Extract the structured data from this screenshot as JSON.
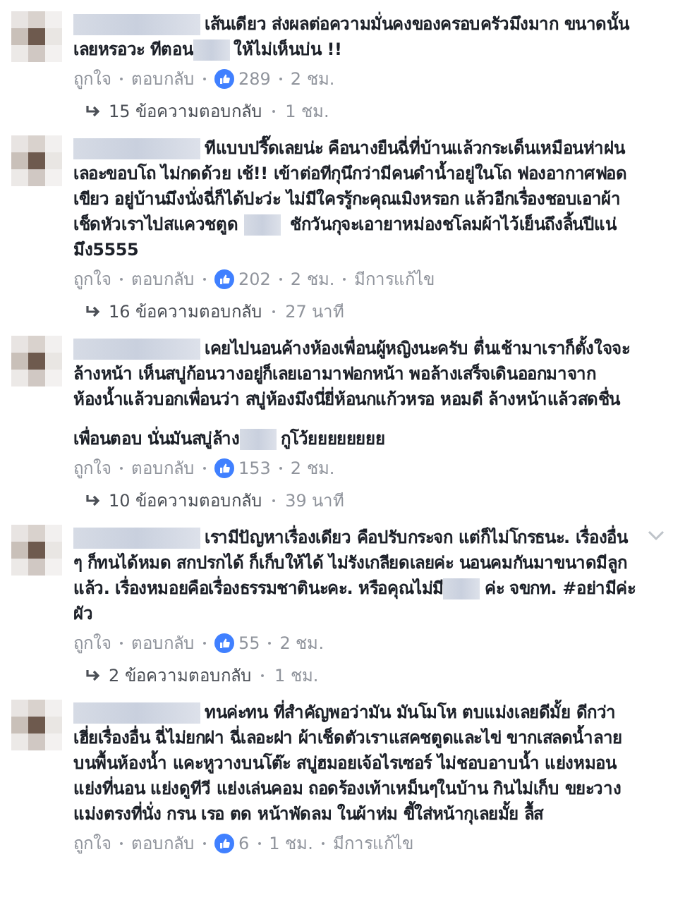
{
  "comments": [
    {
      "paragraphs": [
        [
          {
            "kind": "name"
          },
          {
            "kind": "text",
            "text": "เส้นเดียว ส่งผลต่อความมั่นคงของครอบครัวมึงมาก ขนาดนั้นเลยหรอวะ ทีตอน"
          },
          {
            "kind": "redacted"
          },
          {
            "kind": "text",
            "text": "ให้ไม่เห็นบ่น !!"
          }
        ]
      ],
      "actions": [
        "ถูกใจ",
        "ตอบกลับ"
      ],
      "likes": "289",
      "time": "2 ชม.",
      "replies": {
        "count": "15 ข้อความตอบกลับ",
        "time": "1 ชม."
      },
      "menu": false
    },
    {
      "paragraphs": [
        [
          {
            "kind": "name"
          },
          {
            "kind": "text",
            "text": "ทีแบบปรี๊ดเลยน่ะ คือนางยืนฉี่ที่บ้านแล้วกระเด็นเหมือนห่าฝนเลอะขอบโถ ไม่กดด้วย เช้!! เข้าต่อทีกุนึกว่ามีคนดำน้ำอยู่ในโถ ฟองอากาศฟอดเขียว อยู่บ้านมึงนั่งฉี่ก็ได้ปะว่ะ ไม่มีใครรู้กะคุณเมิงหรอก แล้วอีกเรื่องชอบเอาผ้าเช็ดหัวเราไปสแควชตูด "
          },
          {
            "kind": "redacted"
          },
          {
            "kind": "text",
            "text": " ชักวันกุจะเอายาหม่องชโลมผ้าไว้เย็นถึงลิ้นปีแน่มึง5555"
          }
        ]
      ],
      "actions": [
        "ถูกใจ",
        "ตอบกลับ"
      ],
      "likes": "202",
      "time": "2 ชม.",
      "edited": "มีการแก้ไข",
      "replies": {
        "count": "16 ข้อความตอบกลับ",
        "time": "27 นาที"
      },
      "menu": false
    },
    {
      "paragraphs": [
        [
          {
            "kind": "name"
          },
          {
            "kind": "text",
            "text": "เคยไปนอนค้างห้องเพื่อนผู้หญิงนะครับ ตื่นเช้ามาเราก็ตั้งใจจะล้างหน้า เห็นสบู่ก้อนวางอยู่ก็เลยเอามาฟอกหน้า พอล้างเสร็จเดินออกมาจากห้องน้ำแล้วบอกเพื่อนว่า สบู่ห้องมึงนี่ยี่ห้อนกแก้วหรอ หอมดี ล้างหน้าแล้วสดชื่น"
          }
        ],
        [
          {
            "kind": "text",
            "text": "เพื่อนตอบ นั่นมันสบู่ล้าง"
          },
          {
            "kind": "redacted"
          },
          {
            "kind": "text",
            "text": "กูโว้ยยยยยยยย"
          }
        ]
      ],
      "actions": [
        "ถูกใจ",
        "ตอบกลับ"
      ],
      "likes": "153",
      "time": "2 ชม.",
      "replies": {
        "count": "10 ข้อความตอบกลับ",
        "time": "39 นาที"
      },
      "menu": false
    },
    {
      "paragraphs": [
        [
          {
            "kind": "name"
          },
          {
            "kind": "text",
            "text": "เรามีปัญหาเรื่องเดียว คือปรับกระจก แต่ก็ไม่โกรธนะ. เรื่องอื่น ๆ ก็ทนได้หมด สกปรกได้ ก็เก็บให้ได้ ไม่รังเกลียดเลยค่ะ นอนคมกันมาขนาดมีลูกแล้ว. เรื่องหมอยคือเรื่องธรรมชาตินะคะ. หรือคุณไม่มี"
          },
          {
            "kind": "redacted"
          },
          {
            "kind": "text",
            "text": "ค่ะ จขกท. #อย่ามีค่ะผัว"
          }
        ]
      ],
      "actions": [
        "ถูกใจ",
        "ตอบกลับ"
      ],
      "likes": "55",
      "time": "2 ชม.",
      "replies": {
        "count": "2 ข้อความตอบกลับ",
        "time": "1 ชม."
      },
      "menu": true
    },
    {
      "paragraphs": [
        [
          {
            "kind": "name"
          },
          {
            "kind": "text",
            "text": "ทนค่ะทน ที่สำคัญพอว่ามัน มันโมโห ตบแม่งเลยดีมั้ย ดีกว่าเฮี่ยเรื่องอื่น ฉี่ไม่ยกฝา ฉี่เลอะฝา ผ้าเช็ดตัวเราแสคชตูดและไข่ ขากเสลดน้ำลายบนพื้นห้องน้ำ แคะหูวางบนโต๊ะ สบู่ฮมอยเจ้อไรเซอร์ ไม่ชอบอาบน้ำ แย่งหมอน แย่งที่นอน แย่งดูทีวี แย่งเล่นคอม ถอดร้องเท้าเหม็นๆในบ้าน กินไม่เก็บ ขยะวางแม่งตรงที่นั่ง กรน เรอ ตด หน้าพัดลม ในผ้าห่ม ขี้ใส่หน้ากุเลยมั้ย ลื้ส"
          }
        ]
      ],
      "actions": [
        "ถูกใจ",
        "ตอบกลับ"
      ],
      "likes": "6",
      "time": "1 ชม.",
      "edited": "มีการแก้ไข",
      "menu": false
    }
  ]
}
